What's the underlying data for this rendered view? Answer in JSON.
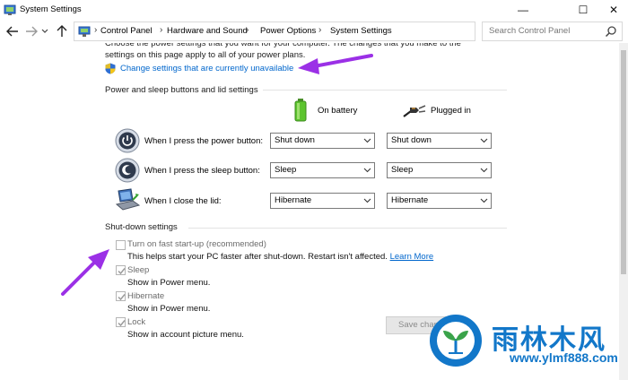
{
  "window": {
    "title": "System Settings",
    "controls": {
      "minimize": "—",
      "maximize": "☐",
      "close": "✕"
    }
  },
  "nav": {
    "back_icon": "back-arrow-icon",
    "forward_icon": "forward-arrow-icon",
    "recent_icon": "chevron-down-icon",
    "up_icon": "up-arrow-icon",
    "breadcrumbs": [
      "Control Panel",
      "Hardware and Sound",
      "Power Options",
      "System Settings"
    ],
    "search_placeholder": "Search Control Panel"
  },
  "intro": {
    "text": "Choose the power settings that you want for your computer. The changes that you make to the settings on this page apply to all of your power plans.",
    "change_link": "Change settings that are currently unavailable"
  },
  "power_section": {
    "heading": "Power and sleep buttons and lid settings",
    "col_battery": "On battery",
    "col_plugged": "Plugged in",
    "rows": [
      {
        "label": "When I press the power button:",
        "battery": "Shut down",
        "plugged": "Shut down",
        "icon": "power-button-icon"
      },
      {
        "label": "When I press the sleep button:",
        "battery": "Sleep",
        "plugged": "Sleep",
        "icon": "sleep-button-icon"
      },
      {
        "label": "When I close the lid:",
        "battery": "Hibernate",
        "plugged": "Hibernate",
        "icon": "laptop-lid-icon"
      }
    ]
  },
  "shutdown_section": {
    "heading": "Shut-down settings",
    "options": [
      {
        "title": "Turn on fast start-up (recommended)",
        "desc": "This helps start your PC faster after shut-down. Restart isn't affected.",
        "link": "Learn More",
        "checked": false
      },
      {
        "title": "Sleep",
        "desc": "Show in Power menu.",
        "checked": true
      },
      {
        "title": "Hibernate",
        "desc": "Show in Power menu.",
        "checked": true
      },
      {
        "title": "Lock",
        "desc": "Show in account picture menu.",
        "checked": true
      }
    ]
  },
  "footer": {
    "save_label": "Save changes"
  },
  "watermark": {
    "brand": "雨林木风",
    "url": "www.ylmf888.com"
  },
  "colors": {
    "link": "#0066cc",
    "annotation_arrow": "#9b30e6",
    "watermark": "#1277c9"
  }
}
